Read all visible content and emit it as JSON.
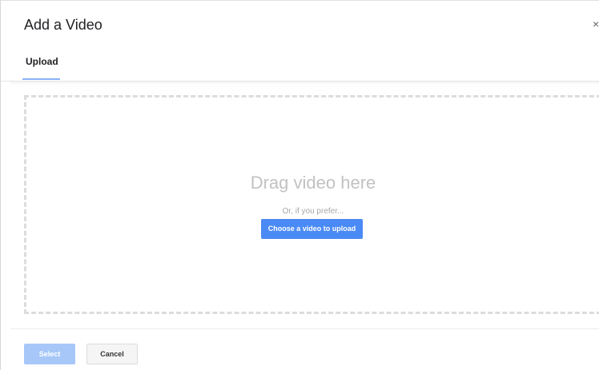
{
  "dialog": {
    "title": "Add a Video",
    "close_icon": "close-icon"
  },
  "tabs": [
    {
      "label": "Upload",
      "active": true
    }
  ],
  "dropzone": {
    "title": "Drag video here",
    "subtitle": "Or, if you prefer...",
    "choose_label": "Choose a video to upload"
  },
  "footer": {
    "select_label": "Select",
    "select_enabled": false,
    "cancel_label": "Cancel"
  },
  "colors": {
    "accent": "#4a8af4",
    "accent_disabled": "#a7c7f8",
    "tab_indicator": "#8ab4f8",
    "dropzone_border": "#dcdcdc"
  }
}
